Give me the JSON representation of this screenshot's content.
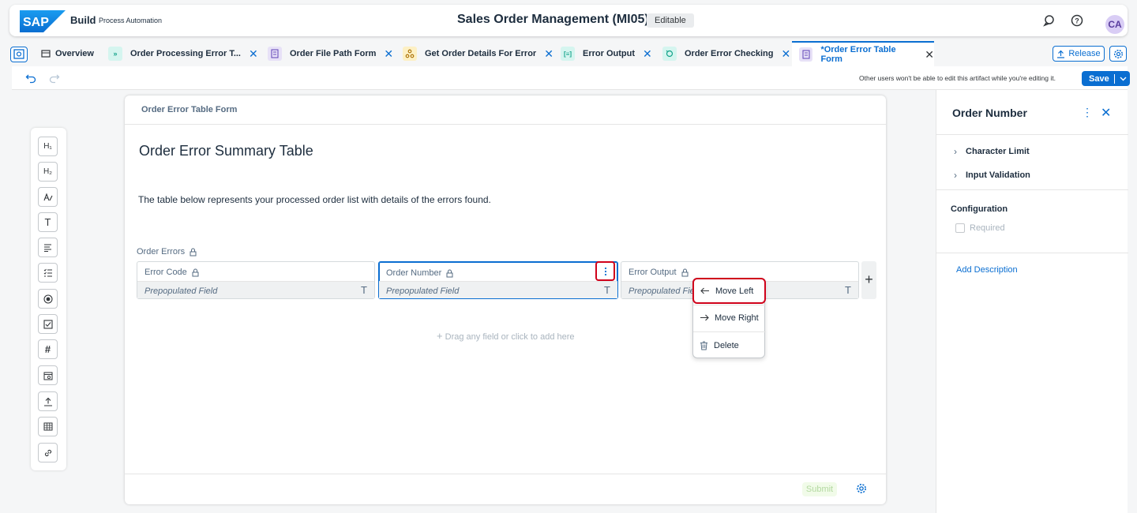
{
  "shell": {
    "brand": "Build",
    "brand_sub": "Process Automation",
    "title": "Sales Order Management (MI05)",
    "badge": "Editable",
    "avatar": "CA"
  },
  "tabs": [
    {
      "label": "Overview"
    },
    {
      "label": "Order Processing Error T..."
    },
    {
      "label": "Order File Path Form"
    },
    {
      "label": "Get Order Details For Error"
    },
    {
      "label": "Error Output"
    },
    {
      "label": "Order Error Checking"
    },
    {
      "label": "*Order Error Table Form"
    }
  ],
  "tabbar": {
    "release_label": "Release"
  },
  "toolbar": {
    "edit_note": "Other users won't be able to edit this artifact while you're editing it.",
    "save_label": "Save"
  },
  "palette": {
    "h1": "H₁",
    "h2": "H₂",
    "text": "T"
  },
  "canvas": {
    "title": "Order Error Table Form",
    "heading": "Order Error Summary Table",
    "description": "The table below represents your processed order list with details of the errors found.",
    "table_label": "Order Errors",
    "columns": [
      {
        "header": "Error Code",
        "placeholder": "Prepopulated Field",
        "type_glyph": "T"
      },
      {
        "header": "Order Number",
        "placeholder": "Prepopulated Field",
        "type_glyph": "T"
      },
      {
        "header": "Error Output",
        "placeholder": "Prepopulated Field",
        "type_glyph": "T"
      }
    ],
    "drag_hint": "Drag any field or click to add here",
    "submit_label": "Submit"
  },
  "context_menu": {
    "items": [
      {
        "label": "Move Left"
      },
      {
        "label": "Move Right"
      },
      {
        "label": "Delete"
      }
    ]
  },
  "panel": {
    "title": "Order Number",
    "sections": [
      {
        "label": "Character Limit"
      },
      {
        "label": "Input Validation"
      }
    ],
    "config_label": "Configuration",
    "required_label": "Required",
    "add_description": "Add Description"
  },
  "colors": {
    "accent": "#0a6ed1",
    "highlight": "#d0021b"
  }
}
